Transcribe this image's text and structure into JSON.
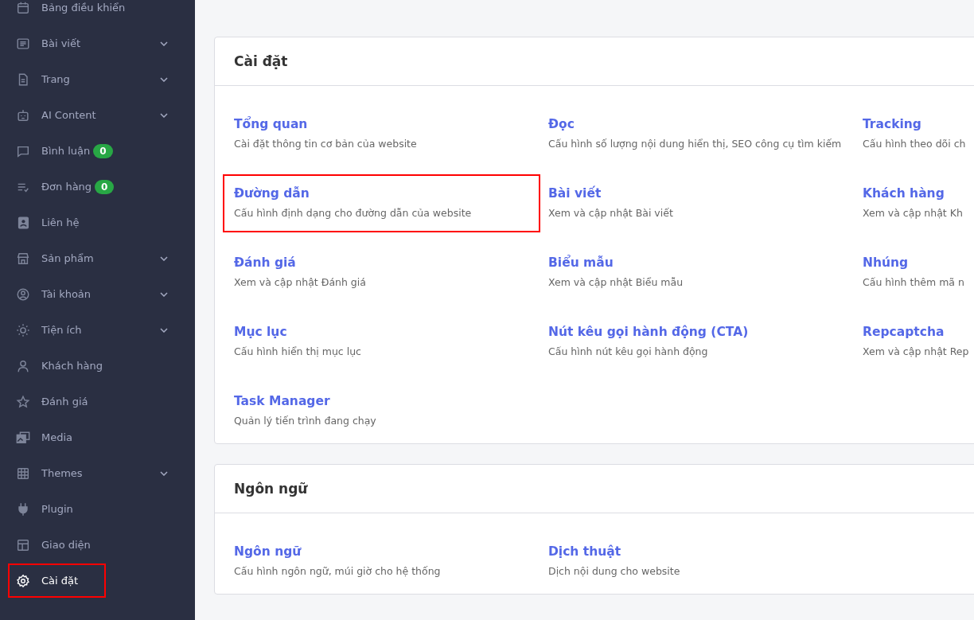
{
  "sidebar": {
    "items": [
      {
        "label": "Bảng điều khiển",
        "expandable": false,
        "selected": false,
        "highlighted": false
      },
      {
        "label": "Bài viết",
        "expandable": true,
        "selected": false,
        "highlighted": false
      },
      {
        "label": "Trang",
        "expandable": true,
        "selected": false,
        "highlighted": false
      },
      {
        "label": "AI Content",
        "expandable": true,
        "selected": false,
        "highlighted": false
      },
      {
        "label": "Bình luận",
        "badge": "0",
        "expandable": false,
        "selected": false,
        "highlighted": false
      },
      {
        "label": "Đơn hàng",
        "badge": "0",
        "expandable": false,
        "selected": false,
        "highlighted": false
      },
      {
        "label": "Liên hệ",
        "expandable": false,
        "selected": false,
        "highlighted": false
      },
      {
        "label": "Sản phẩm",
        "expandable": true,
        "selected": false,
        "highlighted": false
      },
      {
        "label": "Tài khoản",
        "expandable": true,
        "selected": false,
        "highlighted": false
      },
      {
        "label": "Tiện ích",
        "expandable": true,
        "selected": false,
        "highlighted": false
      },
      {
        "label": "Khách hàng",
        "expandable": false,
        "selected": false,
        "highlighted": false
      },
      {
        "label": "Đánh giá",
        "expandable": false,
        "selected": false,
        "highlighted": false
      },
      {
        "label": "Media",
        "expandable": false,
        "selected": false,
        "highlighted": false
      },
      {
        "label": "Themes",
        "expandable": true,
        "selected": false,
        "highlighted": false
      },
      {
        "label": "Plugin",
        "expandable": false,
        "selected": false,
        "highlighted": false
      },
      {
        "label": "Giao diện",
        "expandable": false,
        "selected": false,
        "highlighted": false
      },
      {
        "label": "Cài đặt",
        "expandable": false,
        "selected": true,
        "highlighted": true
      }
    ]
  },
  "sections": [
    {
      "title": "Cài đặt",
      "items": [
        {
          "title": "Tổng quan",
          "description": "Cài đặt thông tin cơ bản của website",
          "highlighted": false
        },
        {
          "title": "Đọc",
          "description": "Cấu hình số lượng nội dung hiển thị, SEO công cụ tìm kiếm",
          "highlighted": false
        },
        {
          "title": "Tracking",
          "description": "Cấu hình theo dõi ch",
          "highlighted": false
        },
        {
          "title": "Đường dẫn",
          "description": "Cấu hình định dạng cho đường dẫn của website",
          "highlighted": true
        },
        {
          "title": "Bài viết",
          "description": "Xem và cập nhật Bài viết",
          "highlighted": false
        },
        {
          "title": "Khách hàng",
          "description": "Xem và cập nhật Kh",
          "highlighted": false
        },
        {
          "title": "Đánh giá",
          "description": "Xem và cập nhật Đánh giá",
          "highlighted": false
        },
        {
          "title": "Biểu mẫu",
          "description": "Xem và cập nhật Biểu mẫu",
          "highlighted": false
        },
        {
          "title": "Nhúng",
          "description": "Cấu hình thêm mã n",
          "highlighted": false
        },
        {
          "title": "Mục lục",
          "description": "Cấu hình hiển thị mục lục",
          "highlighted": false
        },
        {
          "title": "Nút kêu gọi hành động (CTA)",
          "description": "Cấu hình nút kêu gọi hành động",
          "highlighted": false
        },
        {
          "title": "Repcaptcha",
          "description": "Xem và cập nhật Rep",
          "highlighted": false
        },
        {
          "title": "Task Manager",
          "description": "Quản lý tiến trình đang chạy",
          "highlighted": false
        }
      ]
    },
    {
      "title": "Ngôn ngữ",
      "items": [
        {
          "title": "Ngôn ngữ",
          "description": "Cấu hình ngôn ngữ, múi giờ cho hệ thống",
          "highlighted": false
        },
        {
          "title": "Dịch thuật",
          "description": "Dịch nội dung cho website",
          "highlighted": false
        }
      ]
    }
  ]
}
